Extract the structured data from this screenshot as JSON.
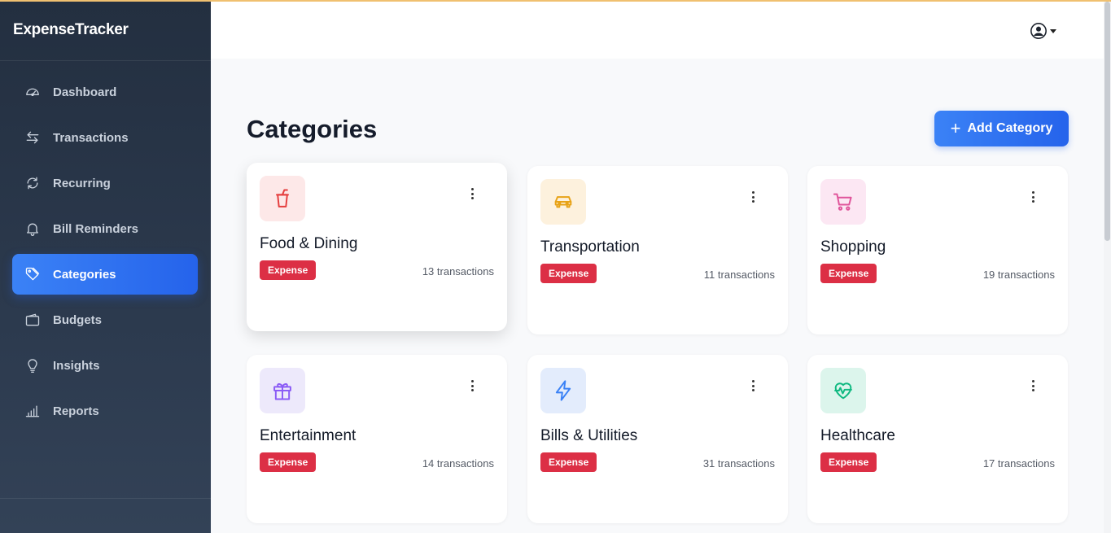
{
  "app": {
    "brand": "ExpenseTracker"
  },
  "sidebar": {
    "items": [
      {
        "label": "Dashboard",
        "icon": "dashboard-icon",
        "active": false
      },
      {
        "label": "Transactions",
        "icon": "arrows-icon",
        "active": false
      },
      {
        "label": "Recurring",
        "icon": "refresh-icon",
        "active": false
      },
      {
        "label": "Bill Reminders",
        "icon": "bell-icon",
        "active": false
      },
      {
        "label": "Categories",
        "icon": "tag-icon",
        "active": true
      },
      {
        "label": "Budgets",
        "icon": "wallet-icon",
        "active": false
      },
      {
        "label": "Insights",
        "icon": "lightbulb-icon",
        "active": false
      },
      {
        "label": "Reports",
        "icon": "bar-chart-icon",
        "active": false
      }
    ]
  },
  "header": {
    "user_icon": "user-circle-icon"
  },
  "main": {
    "title": "Categories",
    "add_button": {
      "label": "Add Category",
      "icon": "plus-icon"
    },
    "categories": [
      {
        "name": "Food & Dining",
        "type": "Expense",
        "transactions": "13 transactions",
        "icon": "cup-icon",
        "color": "#e53e3e",
        "bg": "#fde8e8"
      },
      {
        "name": "Transportation",
        "type": "Expense",
        "transactions": "11 transactions",
        "icon": "car-icon",
        "color": "#e8a317",
        "bg": "#fdf1dd"
      },
      {
        "name": "Shopping",
        "type": "Expense",
        "transactions": "19 transactions",
        "icon": "cart-icon",
        "color": "#e0559b",
        "bg": "#fce7f3"
      },
      {
        "name": "Entertainment",
        "type": "Expense",
        "transactions": "14 transactions",
        "icon": "gift-icon",
        "color": "#8b5cf6",
        "bg": "#ede9fb"
      },
      {
        "name": "Bills & Utilities",
        "type": "Expense",
        "transactions": "31 transactions",
        "icon": "bolt-icon",
        "color": "#3b82f6",
        "bg": "#e3ecfc"
      },
      {
        "name": "Healthcare",
        "type": "Expense",
        "transactions": "17 transactions",
        "icon": "heart-pulse-icon",
        "color": "#10b981",
        "bg": "#dcf5ec"
      }
    ]
  },
  "colors": {
    "accent": "#2563eb",
    "badge": "#dc2f45",
    "sidebar_bg": "#232f40"
  }
}
